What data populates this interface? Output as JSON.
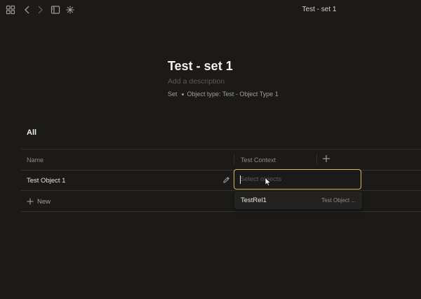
{
  "topbar": {
    "window_title": "Test - set 1",
    "icons": [
      "grid-icon",
      "back-arrow-icon",
      "forward-arrow-icon",
      "sidebar-icon",
      "graph-icon"
    ]
  },
  "header": {
    "title": "Test - set 1",
    "description_placeholder": "Add a description",
    "meta_type": "Set",
    "meta_object_type": "Object type: Test - Object Type 1"
  },
  "view": {
    "tab_label": "All"
  },
  "table": {
    "columns": [
      "Name",
      "Test Context"
    ],
    "rows": [
      {
        "name": "Test Object 1",
        "test_context": ""
      }
    ],
    "new_label": "New"
  },
  "cell_editor": {
    "placeholder": "Select objects",
    "options": [
      {
        "name": "TestRel1",
        "type": "Test Object ..."
      }
    ]
  },
  "colors": {
    "background": "#1b1a19",
    "accent_border": "#e3b547",
    "text_primary": "#e8e6e3",
    "text_muted": "#8e8b87",
    "divider": "#34322f"
  }
}
